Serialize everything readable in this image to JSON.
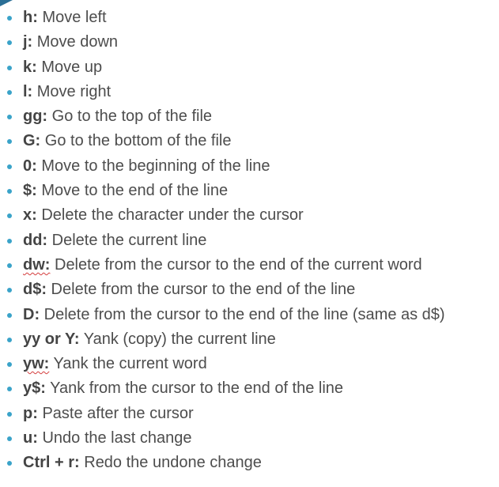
{
  "commands": [
    {
      "key": "h:",
      "desc": " Move left"
    },
    {
      "key": "j:",
      "desc": " Move down"
    },
    {
      "key": "k:",
      "desc": " Move up"
    },
    {
      "key": "l:",
      "desc": " Move right"
    },
    {
      "key": "gg:",
      "desc": " Go to the top of the file"
    },
    {
      "key": "G:",
      "desc": " Go to the bottom of the file"
    },
    {
      "key": "0:",
      "desc": " Move to the beginning of the line"
    },
    {
      "key": "$:",
      "desc": " Move to the end of the line"
    },
    {
      "key": "x:",
      "desc": " Delete the character under the cursor"
    },
    {
      "key": "dd:",
      "desc": " Delete the current line"
    },
    {
      "key": "dw:",
      "desc": " Delete from the cursor to the end of the current word"
    },
    {
      "key": "d$:",
      "desc": " Delete from the cursor to the end of the line"
    },
    {
      "key": "D:",
      "desc": " Delete from the cursor to the end of the line (same as d$)"
    },
    {
      "key": "yy or Y:",
      "desc": " Yank (copy) the current line"
    },
    {
      "key": "yw:",
      "desc": " Yank the current word"
    },
    {
      "key": "y$:",
      "desc": " Yank from the cursor to the end of the line"
    },
    {
      "key": "p:",
      "desc": " Paste after the cursor"
    },
    {
      "key": "u:",
      "desc": " Undo the last change"
    },
    {
      "key": "Ctrl + r:",
      "desc": " Redo the undone change"
    }
  ],
  "colors": {
    "bullet": "#3aa3c9",
    "text": "#4d4d4d",
    "corner_accent": "#2a6f96",
    "spellcheck_underline": "#d43c3c"
  }
}
